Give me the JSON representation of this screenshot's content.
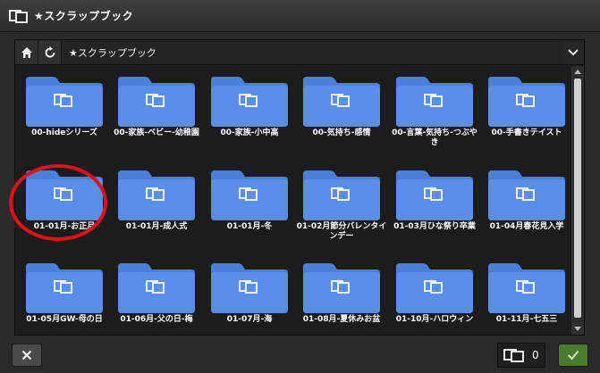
{
  "window": {
    "title": "★スクラップブック",
    "icon": "scrapbook-icon"
  },
  "navbar": {
    "home_icon": "home-icon",
    "refresh_icon": "refresh-icon",
    "path": "★スクラップブック",
    "dropdown_icon": "chevron-down-icon"
  },
  "folders": [
    "00-hideシリーズ",
    "00-家族-ベビー-幼稚園",
    "00-家族-小中高",
    "00-気持ち-感情",
    "00-言葉-気持ち-つぶやき",
    "00-手書きテイスト",
    "01-01月-お正月",
    "01-01月-成人式",
    "01-01月-冬",
    "01-02月節分バレンタインデー",
    "01-03月ひな祭り卒業",
    "01-04月春花見入学",
    "01-05月GW-母の日",
    "01-06月-父の日-梅",
    "01-07月-海",
    "01-08月-夏休みお盆",
    "01-10月-ハロウィン",
    "01-11月-七五三"
  ],
  "selected_folder": "01-01月-お正月",
  "footer": {
    "close_icon": "close-icon",
    "count": "0",
    "count_icon": "scrapbook-icon",
    "ok_icon": "check-icon"
  },
  "colors": {
    "folder": "#5b8ee6",
    "folder_tab": "#4d7fd6",
    "highlight": "#e0101a",
    "ok": "#4c7a2e"
  }
}
